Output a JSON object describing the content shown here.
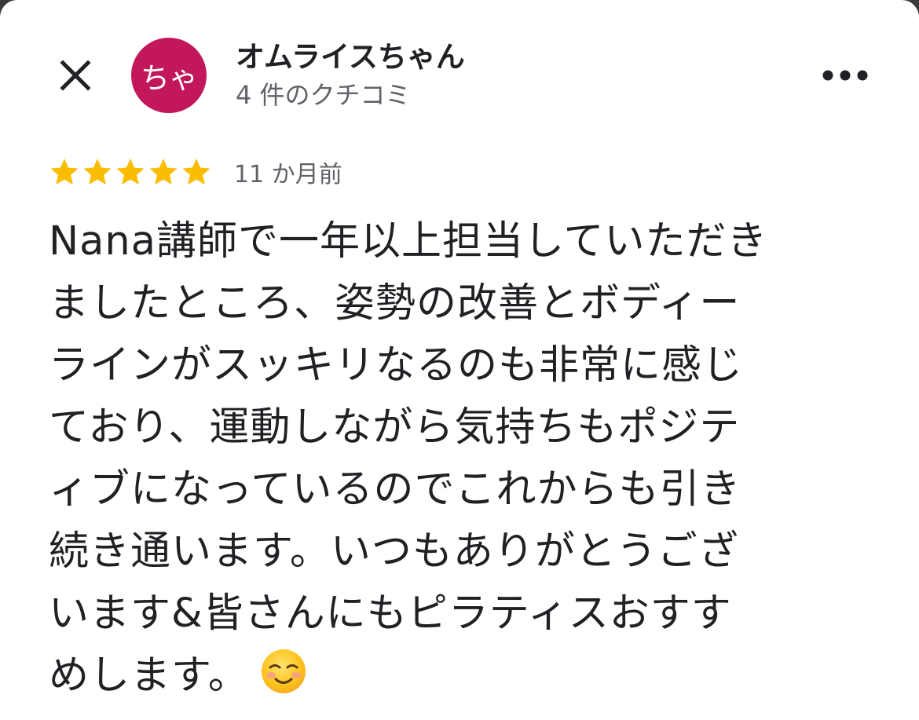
{
  "header": {
    "close_icon": "close-icon",
    "avatar_text": "ちゃ",
    "avatar_color": "#c2185b",
    "user_name": "オムライスちゃん",
    "review_count": "4 件のクチコミ",
    "more_icon": "more-horizontal-icon"
  },
  "review": {
    "rating": 5,
    "max_rating": 5,
    "star_color": "#fbbc04",
    "time_ago": "11 か月前",
    "text": "Nana講師で一年以上担当していただき\nましたところ、姿勢の改善とボディー\nラインがスッキリなるのも非常に感じ\nており、運動しながら気持ちもポジテ\nィブになっているのでこれからも引き\n続き通います。いつもありがとうござ\nいます&皆さんにもピラティスおすす\nめします。",
    "emoji": "smiling-face-icon"
  }
}
